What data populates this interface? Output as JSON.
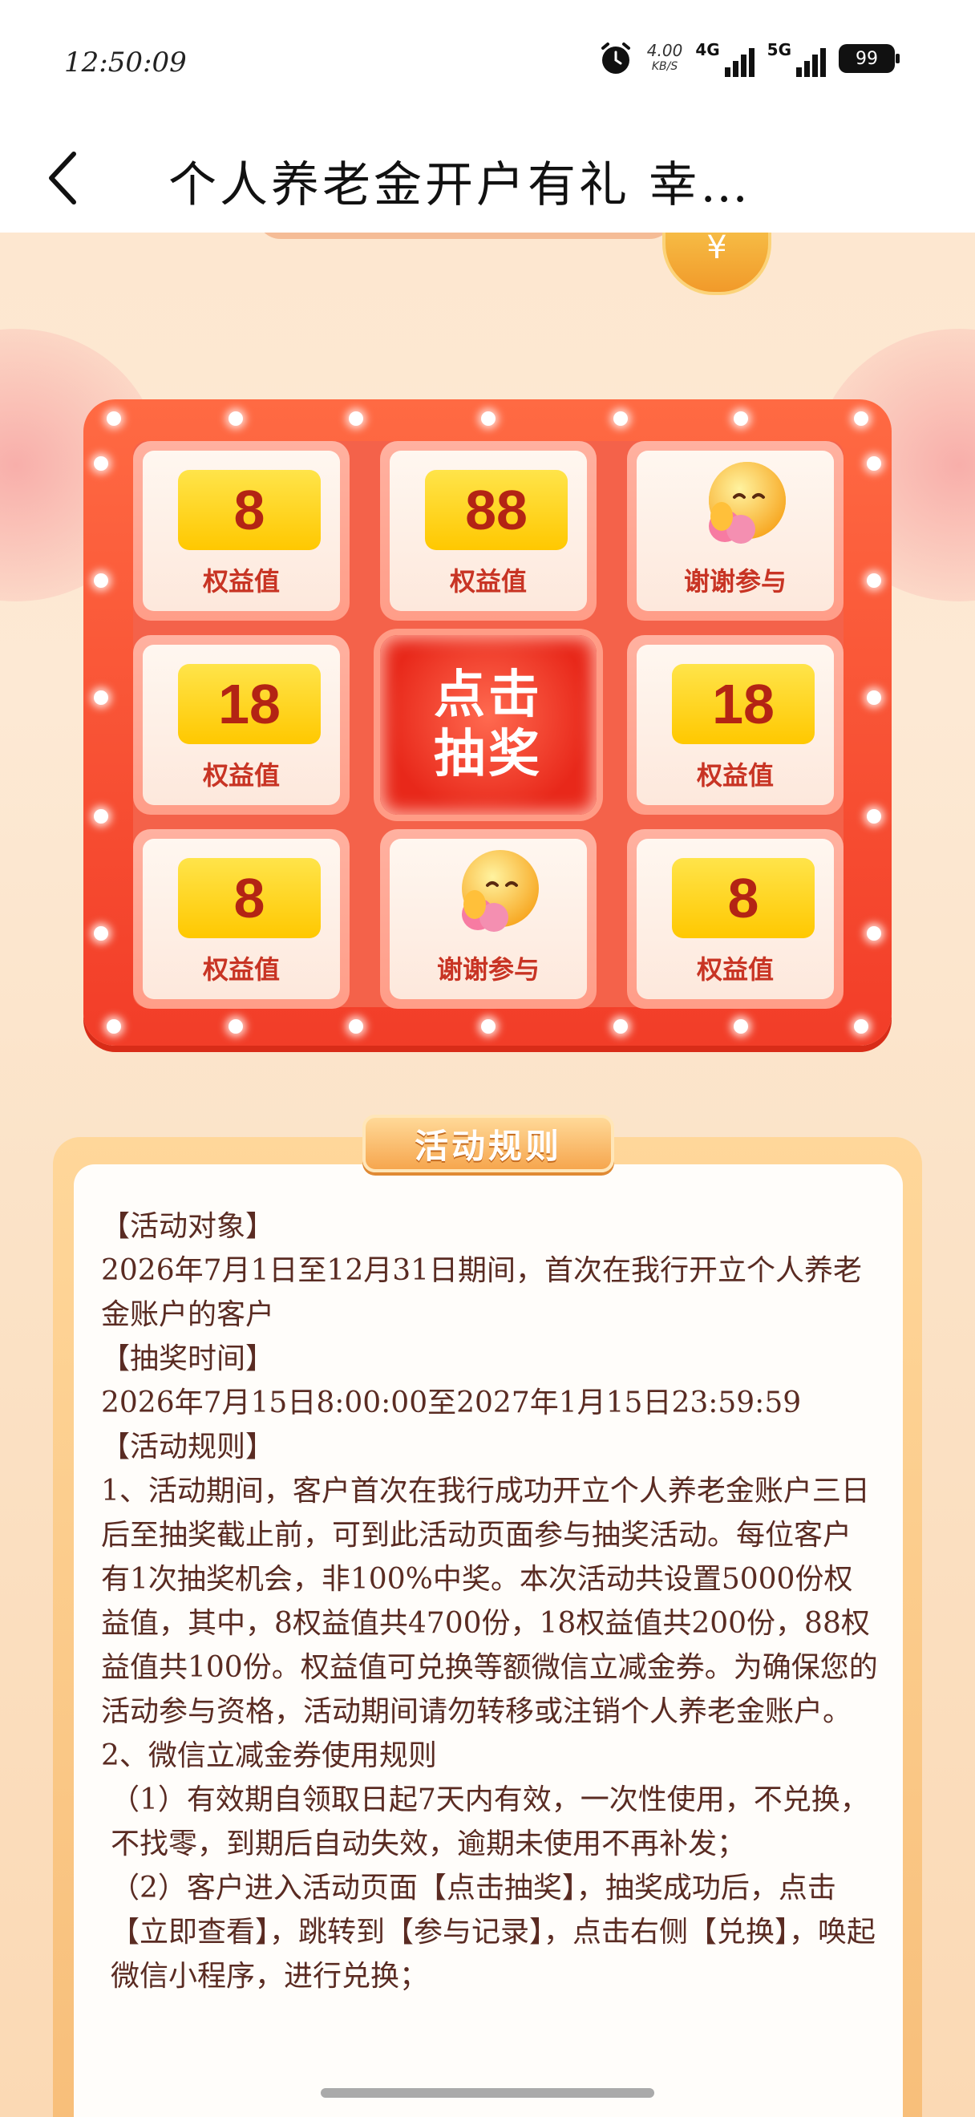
{
  "status_bar": {
    "time": "12:50:09",
    "speed": "4.00",
    "speed_unit": "KB/S",
    "net1": "4G",
    "net2": "5G",
    "battery": "99"
  },
  "header": {
    "title": "个人养老金开户有礼 幸…"
  },
  "lottery": {
    "cells": [
      {
        "value": "8",
        "label": "权益值"
      },
      {
        "value": "88",
        "label": "权益值"
      },
      {
        "value": "",
        "label": "谢谢参与"
      },
      {
        "value": "18",
        "label": "权益值"
      },
      {
        "value": "18",
        "label": "权益值"
      },
      {
        "value": "8",
        "label": "权益值"
      },
      {
        "value": "",
        "label": "谢谢参与"
      },
      {
        "value": "8",
        "label": "权益值"
      }
    ],
    "draw_line1": "点击",
    "draw_line2": "抽奖"
  },
  "rules": {
    "title": "活动规则",
    "lines": [
      "【活动对象】",
      "2026年7月1日至12月31日期间，首次在我行开立个人养老金账户的客户",
      "【抽奖时间】",
      "2026年7月15日8:00:00至2027年1月15日23:59:59",
      "【活动规则】",
      "1、活动期间，客户首次在我行成功开立个人养老金账户三日后至抽奖截止前，可到此活动页面参与抽奖活动。每位客户有1次抽奖机会，非100%中奖。本次活动共设置5000份权益值，其中，8权益值共4700份，18权益值共200份，88权益值共100份。权益值可兑换等额微信立减金券。为确保您的活动参与资格，活动期间请勿转移或注销个人养老金账户。",
      "2、微信立减金券使用规则",
      "（1）有效期自领取日起7天内有效，一次性使用，不兑换，不找零，到期后自动失效，逾期未使用不再补发；",
      "（2）客户进入活动页面【点击抽奖】，抽奖成功后，点击【立即查看】，跳转到【参与记录】，点击右侧【兑换】，唤起微信小程序，进行兑换；"
    ]
  }
}
